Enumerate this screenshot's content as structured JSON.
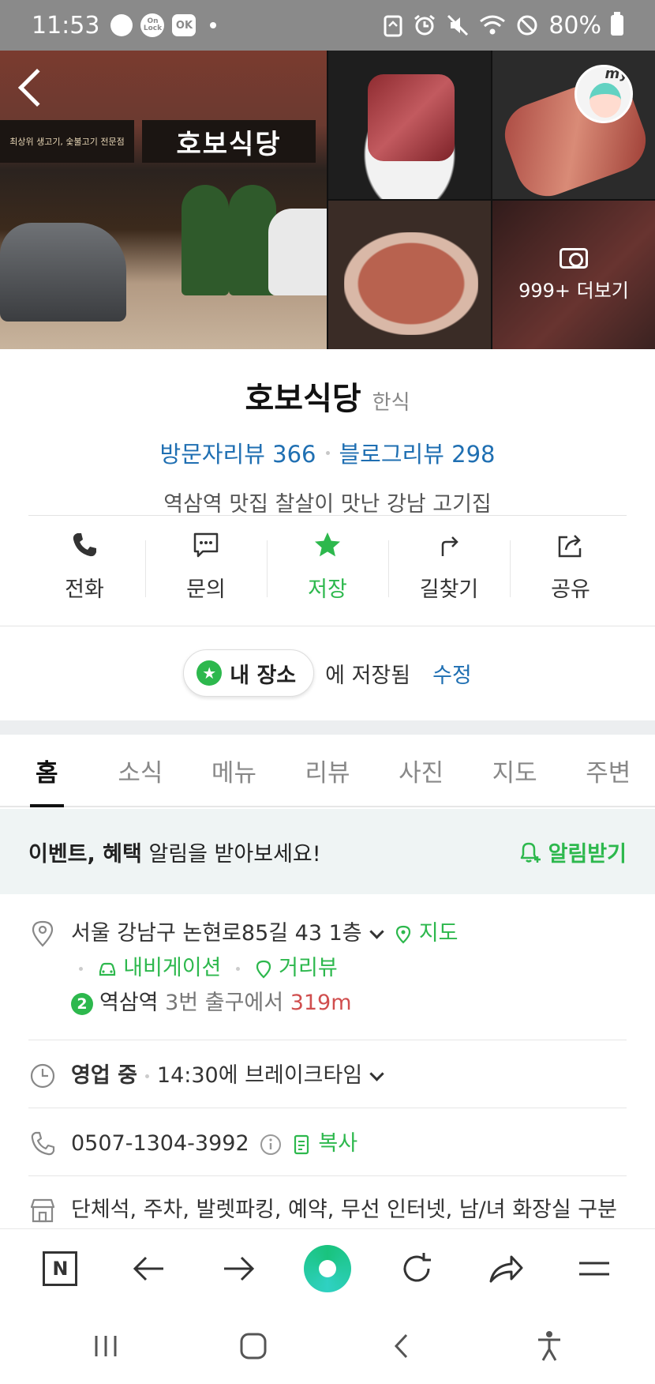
{
  "status_bar": {
    "time": "11:53",
    "lock_badge": "On Lock",
    "ok_badge": "OK",
    "battery": "80%"
  },
  "photos": {
    "store_sign": "호보식당",
    "store_subsign": "최상위 생고기, 숯불고기 전문점",
    "more_label": "999+ 더보기",
    "avatar_label": "my"
  },
  "place": {
    "name": "호보식당",
    "category": "한식",
    "visitor_reviews": "방문자리뷰 366",
    "blog_reviews": "블로그리뷰 298",
    "description": "역삼역 맛집 찰살이 맛난 강남 고기집"
  },
  "actions": [
    {
      "label": "전화",
      "icon": "phone-icon"
    },
    {
      "label": "문의",
      "icon": "chat-icon"
    },
    {
      "label": "저장",
      "icon": "star-icon"
    },
    {
      "label": "길찾기",
      "icon": "directions-icon"
    },
    {
      "label": "공유",
      "icon": "share-icon"
    }
  ],
  "saved": {
    "pill_label": "내 장소",
    "saved_text": "에 저장됨",
    "edit_label": "수정"
  },
  "tabs": [
    "홈",
    "소식",
    "메뉴",
    "리뷰",
    "사진",
    "지도",
    "주변"
  ],
  "event": {
    "bold_text": "이벤트, 혜택",
    "text": " 알림을 받아보세요!",
    "button_label": "알림받기"
  },
  "info": {
    "address": "서울 강남구 논현로85길 43 1층",
    "map_label": "지도",
    "navigation_label": "내비게이션",
    "streetview_label": "거리뷰",
    "subway_line": "2",
    "subway_station": "역삼역",
    "subway_exit": "3번 출구에서",
    "subway_distance": "319m",
    "hours_status": "영업 중",
    "hours_detail": "14:30에 브레이크타임",
    "phone": "0507-1304-3992",
    "copy_label": "복사",
    "amenities": "단체석, 주차, 발렛파킹, 예약, 무선 인터넷, 남/녀 화장실 구분"
  },
  "colors": {
    "accent_green": "#2db84d",
    "link_blue": "#1f6fb2",
    "distance_red": "#d04e4e"
  }
}
